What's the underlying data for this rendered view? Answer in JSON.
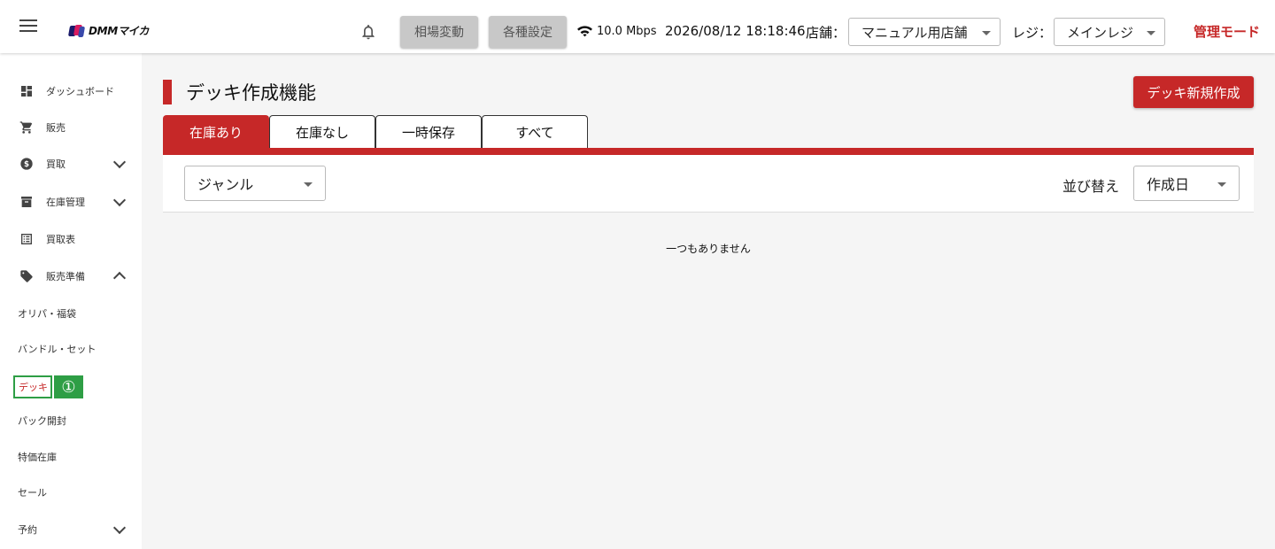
{
  "header": {
    "logo_text": "DMMマイカ",
    "btn_market": "相場変動",
    "btn_settings": "各種設定",
    "speed": "10.0 Mbps",
    "datetime": "2026/08/12 18:18:46",
    "store_label": "店舗：",
    "store_value": "マニュアル用店舗",
    "register_label": "レジ：",
    "register_value": "メインレジ",
    "admin_mode": "管理モード"
  },
  "sidebar": {
    "items": [
      {
        "label": "ダッシュボード"
      },
      {
        "label": "販売"
      },
      {
        "label": "買取"
      },
      {
        "label": "在庫管理"
      },
      {
        "label": "買取表"
      },
      {
        "label": "販売準備"
      }
    ],
    "sub_items": [
      {
        "label": "オリパ・福袋"
      },
      {
        "label": "バンドル・セット"
      },
      {
        "label": "デッキ"
      },
      {
        "label": "パック開封"
      },
      {
        "label": "特価在庫"
      },
      {
        "label": "セール"
      }
    ],
    "reserve": "予約",
    "badge": "①"
  },
  "main": {
    "title": "デッキ作成機能",
    "new_button": "デッキ新規作成",
    "tabs": [
      {
        "label": "在庫あり"
      },
      {
        "label": "在庫なし"
      },
      {
        "label": "一時保存"
      },
      {
        "label": "すべて"
      }
    ],
    "genre_select": "ジャンル",
    "sort_label": "並び替え",
    "sort_select": "作成日",
    "empty_message": "一つもありません"
  },
  "colors": {
    "accent": "#c62828",
    "highlight": "#2e9e45"
  }
}
